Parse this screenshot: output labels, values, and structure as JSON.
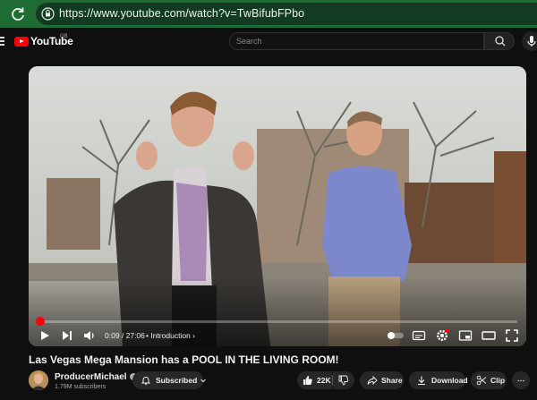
{
  "browser": {
    "url": "https://www.youtube.com/watch?v=TwBifubFPbo"
  },
  "header": {
    "logo_text": "YouTube",
    "region": "GB",
    "search_placeholder": "Search"
  },
  "player": {
    "progress_fraction": 0.0055,
    "current_time": "0:09",
    "duration": "27:06",
    "time_display": "0:09 / 27:06",
    "chapter": "Introduction",
    "chapter_separator": "•",
    "chapter_chevron": "›",
    "icons": [
      "play-icon",
      "next-icon",
      "volume-icon",
      "autoplay-toggle-icon",
      "subtitles-icon",
      "settings-icon",
      "miniplayer-icon",
      "theater-icon",
      "fullscreen-icon"
    ]
  },
  "video": {
    "title": "Las Vegas Mega Mansion has a POOL IN THE LIVING ROOM!"
  },
  "channel": {
    "name": "ProducerMichael",
    "subscribers": "1.79M subscribers"
  },
  "actions": {
    "subscribed_label": "Subscribed",
    "like_count": "22K",
    "share_label": "Share",
    "download_label": "Download",
    "clip_label": "Clip",
    "more_label": "⋯"
  },
  "colors": {
    "browser_bar": "#1e6b34",
    "page_bg": "#0f0f0f",
    "accent_red": "#ff0000",
    "pill_bg": "#272727"
  }
}
